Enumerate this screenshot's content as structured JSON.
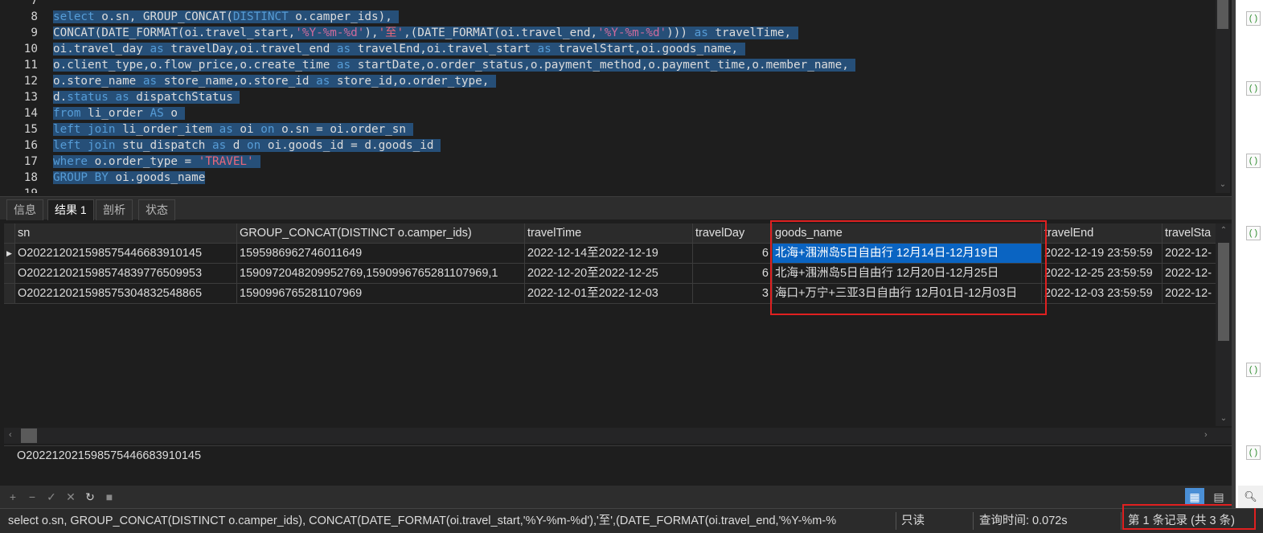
{
  "editor": {
    "lines": [
      {
        "num": "7",
        "html": ""
      },
      {
        "num": "8",
        "html": "<span class='sel'><span class='kw'>select</span> o.sn, GROUP_CONCAT(<span class='kw'>DISTINCT</span> o.camper_ids), </span>"
      },
      {
        "num": "9",
        "html": "<span class='sel'>CONCAT(DATE_FORMAT(oi.travel_start,<span class='str'>'%Y-%m-%d'</span>),<span class='strred'>'至'</span>,(DATE_FORMAT(oi.travel_end,<span class='str'>'%Y-%m-%d'</span>))) <span class='kw'>as</span> travelTime, </span>"
      },
      {
        "num": "10",
        "html": "<span class='sel'>oi.travel_day <span class='kw'>as</span> travelDay,oi.travel_end <span class='kw'>as</span> travelEnd,oi.travel_start <span class='kw'>as</span> travelStart,oi.goods_name, </span>"
      },
      {
        "num": "11",
        "html": "<span class='sel'>o.client_type,o.flow_price,o.create_time <span class='kw'>as</span> startDate,o.order_status,o.payment_method,o.payment_time,o.member_name, </span>"
      },
      {
        "num": "12",
        "html": "<span class='sel'>o.store_name <span class='kw'>as</span> store_name,o.store_id <span class='kw'>as</span> store_id,o.order_type, </span>"
      },
      {
        "num": "13",
        "html": "<span class='sel'>d.<span class='kw'>status</span> <span class='kw'>as</span> dispatchStatus </span>"
      },
      {
        "num": "14",
        "html": "<span class='sel'><span class='kw'>from</span> li_order <span class='kw'>AS</span> o </span>"
      },
      {
        "num": "15",
        "html": "<span class='sel'><span class='kw'>left join</span> li_order_item <span class='kw'>as</span> oi <span class='kw'>on</span> o.sn = oi.order_sn </span>"
      },
      {
        "num": "16",
        "html": "<span class='sel'><span class='kw'>left join</span> stu_dispatch <span class='kw'>as</span> d <span class='kw'>on</span> oi.goods_id = d.goods_id </span>"
      },
      {
        "num": "17",
        "html": "<span class='sel'><span class='kw'>where</span> o.order_type = <span class='strred'>'TRAVEL'</span> </span>"
      },
      {
        "num": "18",
        "html": "<span class='sel'><span class='kw'>GROUP BY</span> oi.goods_name</span>"
      },
      {
        "num": "19",
        "html": ""
      }
    ]
  },
  "tabs": [
    {
      "label": "信息",
      "active": false
    },
    {
      "label": "结果 1",
      "active": true
    },
    {
      "label": "剖析",
      "active": false
    },
    {
      "label": "状态",
      "active": false
    }
  ],
  "grid": {
    "columns": [
      {
        "label": "sn"
      },
      {
        "label": "GROUP_CONCAT(DISTINCT o.camper_ids)"
      },
      {
        "label": "travelTime"
      },
      {
        "label": "travelDay"
      },
      {
        "label": "goods_name"
      },
      {
        "label": "travelEnd"
      },
      {
        "label": "travelSta"
      }
    ],
    "rows": [
      [
        "O202212021598575446683910145",
        "1595986962746011649",
        "2022-12-14至2022-12-19",
        "6",
        "北海+涠洲岛5日自由行 12月14日-12月19日",
        "2022-12-19 23:59:59",
        "2022-12-"
      ],
      [
        "O202212021598574839776509953",
        "1590972048209952769,1590996765281107969,1",
        "2022-12-20至2022-12-25",
        "6",
        "北海+涠洲岛5日自由行 12月20日-12月25日",
        "2022-12-25 23:59:59",
        "2022-12-"
      ],
      [
        "O202212021598575304832548865",
        "1590996765281107969",
        "2022-12-01至2022-12-03",
        "3",
        "海口+万宁+三亚3日自由行 12月01日-12月03日",
        "2022-12-03 23:59:59",
        "2022-12-"
      ]
    ]
  },
  "viewer": {
    "value": "O202212021598575446683910145"
  },
  "toolbar": {
    "add": "+",
    "remove": "−",
    "apply": "✓",
    "discard": "✕",
    "refresh": "↻",
    "stop": "■"
  },
  "status": {
    "query": "select o.sn, GROUP_CONCAT(DISTINCT o.camper_ids), CONCAT(DATE_FORMAT(oi.travel_start,'%Y-%m-%d'),'至',(DATE_FORMAT(oi.travel_end,'%Y-%m-%",
    "readonly": "只读",
    "query_time": "查询时间: 0.072s",
    "record": "第 1 条记录 (共 3 条)"
  },
  "colors": {
    "accent": "#0a64c2",
    "highlight_box": "#e02020"
  }
}
